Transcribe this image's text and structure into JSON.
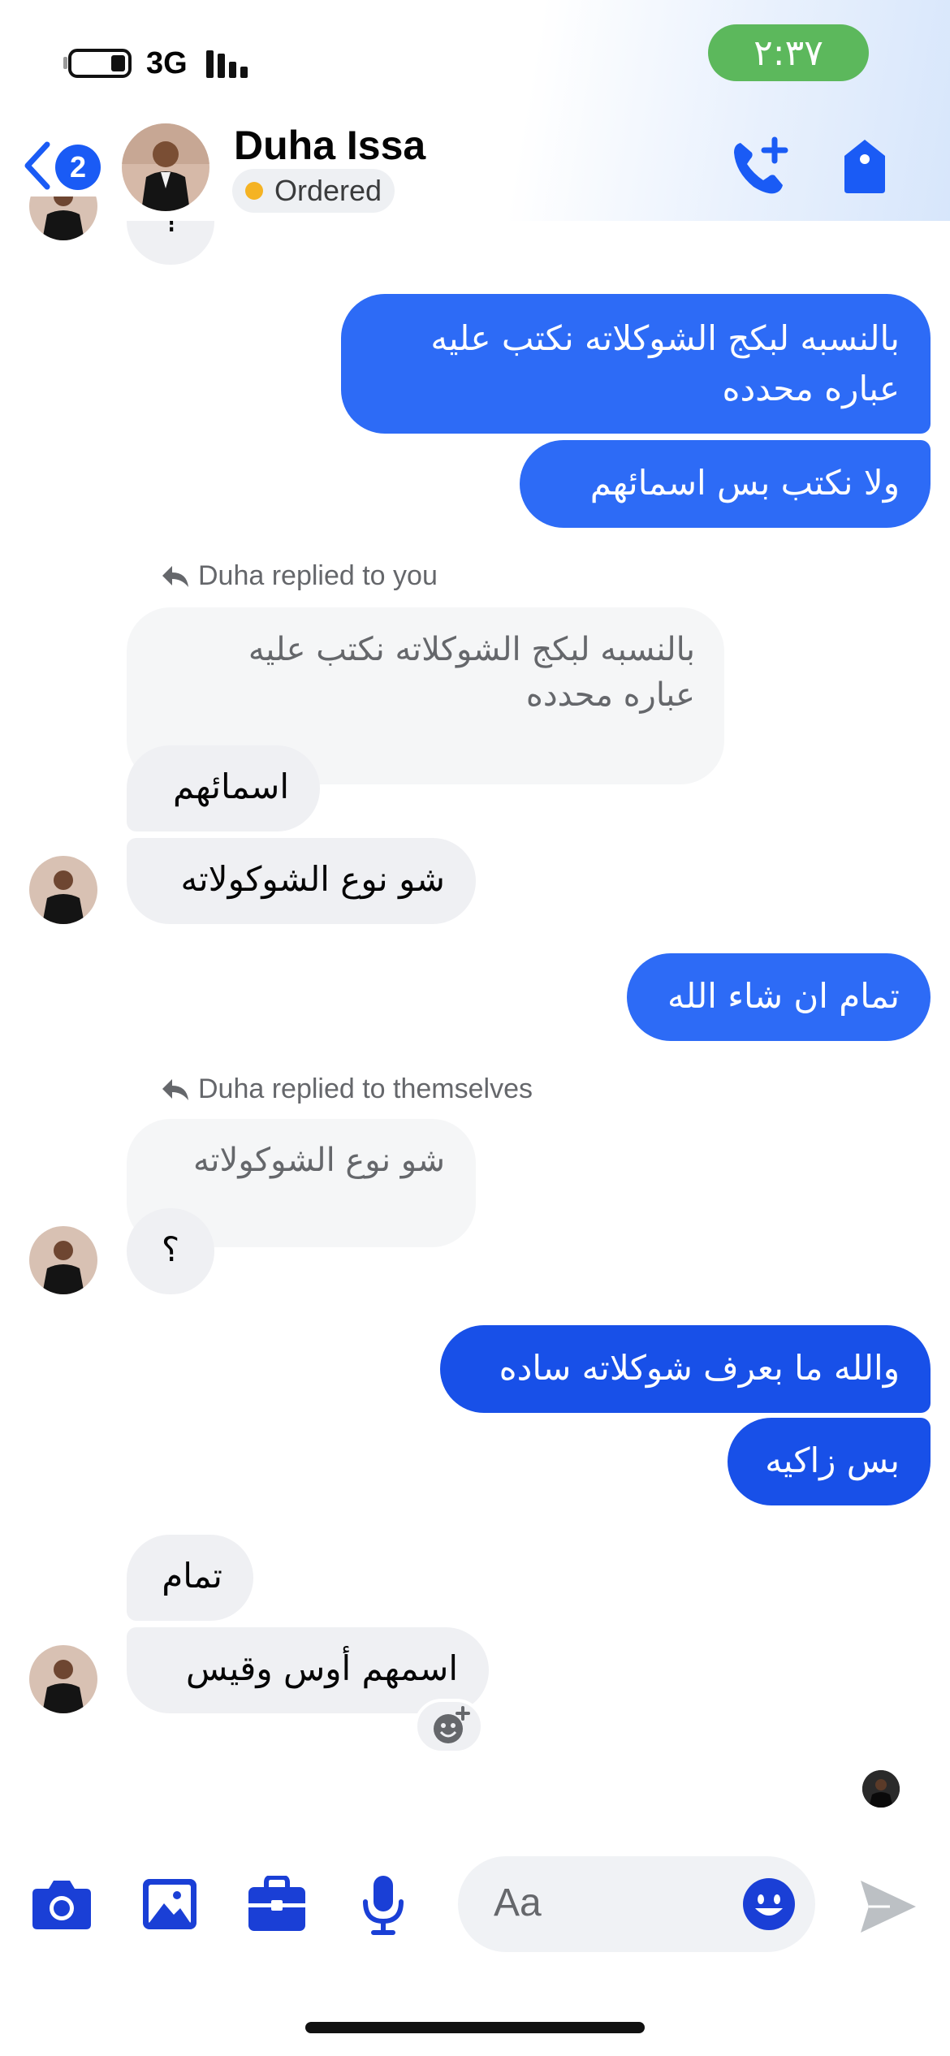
{
  "status_bar": {
    "network": "3G",
    "time": "٢:٣٧"
  },
  "header": {
    "back_count": "2",
    "contact_name": "Duha Issa",
    "contact_status": "Ordered"
  },
  "messages": {
    "top_partial": "؟",
    "out1_line1": "بالنسبه لبكج الشوكلاته نكتب عليه",
    "out1_line2": "عباره محدده",
    "out2": "ولا نكتب بس اسمائهم",
    "reply1_note": "Duha replied to you",
    "reply1_quote_line1": "بالنسبه لبكج الشوكلاته نكتب عليه",
    "reply1_quote_line2": "عباره محدده",
    "in1": "اسمائهم",
    "in2": "شو نوع الشوكولاته",
    "out3": "تمام ان شاء الله",
    "reply2_note": "Duha replied to themselves",
    "reply2_quote": "شو نوع الشوكولاته",
    "in3": "؟",
    "out4": "والله ما بعرف شوكلاته ساده",
    "out5": "بس زاكيه",
    "in4": "تمام",
    "in5": "اسمهم أوس وقيس"
  },
  "composer": {
    "placeholder": "Aa"
  },
  "colors": {
    "accent": "#1a5bf5",
    "outgoing": "#2d6bf6",
    "outgoing_dark": "#1850e8",
    "incoming": "#eff0f3",
    "time_pill": "#5cb85c",
    "ordered_dot": "#f5b323"
  },
  "icons": [
    "back-chevron-icon",
    "add-call-icon",
    "tag-icon",
    "reply-arrow-icon",
    "add-reaction-icon",
    "camera-icon",
    "photo-icon",
    "briefcase-icon",
    "microphone-icon",
    "emoji-icon",
    "send-icon"
  ]
}
